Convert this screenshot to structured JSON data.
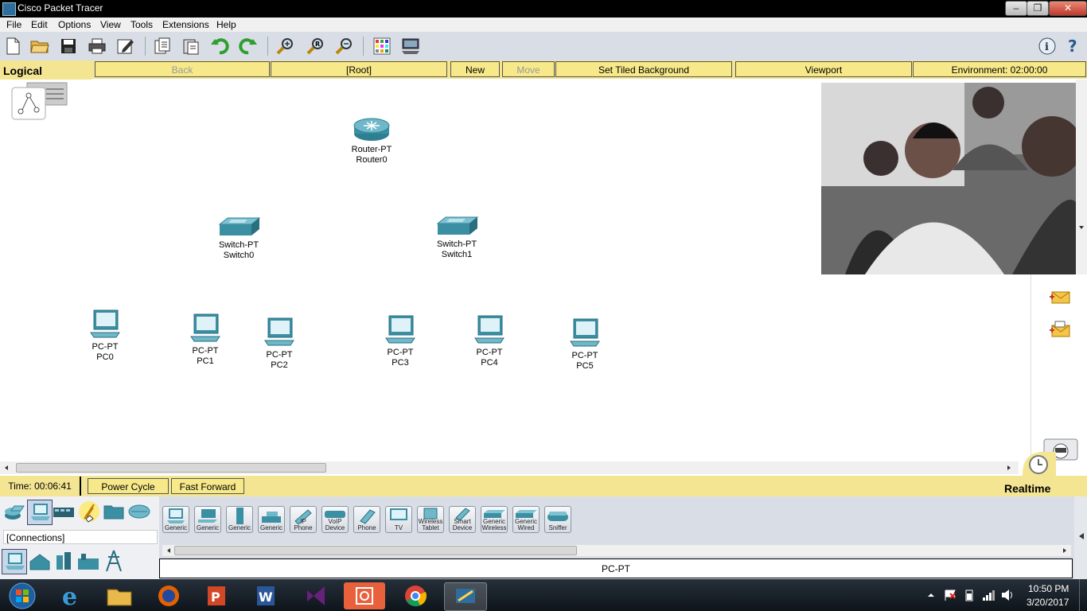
{
  "window": {
    "title": "Cisco Packet Tracer"
  },
  "menu": [
    "File",
    "Edit",
    "Options",
    "View",
    "Tools",
    "Extensions",
    "Help"
  ],
  "nav": {
    "logical": "Logical",
    "back": "Back",
    "root": "[Root]",
    "new_cluster": "New Cluster",
    "move_object": "Move Object",
    "set_tiled_background": "Set Tiled Background",
    "viewport": "Viewport",
    "environment": "Environment: 02:00:00"
  },
  "devices": [
    {
      "type": "Router-PT",
      "name": "Router0"
    },
    {
      "type": "Switch-PT",
      "name": "Switch0"
    },
    {
      "type": "Switch-PT",
      "name": "Switch1"
    },
    {
      "type": "PC-PT",
      "name": "PC0"
    },
    {
      "type": "PC-PT",
      "name": "PC1"
    },
    {
      "type": "PC-PT",
      "name": "PC2"
    },
    {
      "type": "PC-PT",
      "name": "PC3"
    },
    {
      "type": "PC-PT",
      "name": "PC4"
    },
    {
      "type": "PC-PT",
      "name": "PC5"
    }
  ],
  "status": {
    "time": "Time: 00:06:41",
    "power_cycle": "Power Cycle Devices",
    "fast_forward": "Fast Forward Time",
    "realtime": "Realtime"
  },
  "bottom": {
    "connections": "[Connections]",
    "model": "PC-PT",
    "end_devices": [
      {
        "line1": "",
        "line2": "Generic"
      },
      {
        "line1": "",
        "line2": "Generic"
      },
      {
        "line1": "",
        "line2": "Generic"
      },
      {
        "line1": "",
        "line2": "Generic"
      },
      {
        "line1": "",
        "line2": "IP Phone"
      },
      {
        "line1": "VoIP",
        "line2": "Device"
      },
      {
        "line1": "",
        "line2": "Phone"
      },
      {
        "line1": "",
        "line2": "TV"
      },
      {
        "line1": "Wireless",
        "line2": "Tablet"
      },
      {
        "line1": "Smart",
        "line2": "Device"
      },
      {
        "line1": "Generic",
        "line2": "Wireless"
      },
      {
        "line1": "Generic",
        "line2": "Wired"
      },
      {
        "line1": "",
        "line2": "Sniffer"
      }
    ]
  },
  "taskbar": {
    "time": "10:50 PM",
    "date": "3/20/2017"
  },
  "colors": {
    "yellow_bar": "#f4e593",
    "device_teal": "#3b8fa3"
  }
}
